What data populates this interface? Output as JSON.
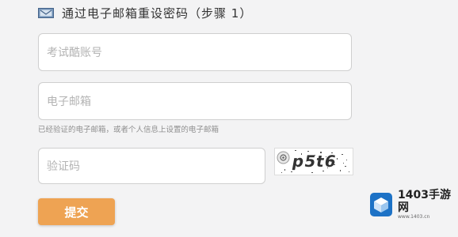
{
  "header": {
    "title": "通过电子邮箱重设密码（步骤 1）",
    "icon": "email-icon"
  },
  "form": {
    "account_placeholder": "考试酷账号",
    "email_placeholder": "电子邮箱",
    "email_hint": "已经验证的电子邮箱，或者个人信息上设置的电子邮箱",
    "code_placeholder": "验证码",
    "captcha_text": "p5t6",
    "submit_label": "提交"
  },
  "watermark": {
    "name": "1403手游网",
    "url": "www.1403.cn"
  },
  "colors": {
    "accent": "#eea353",
    "background": "#f3f3f4"
  }
}
